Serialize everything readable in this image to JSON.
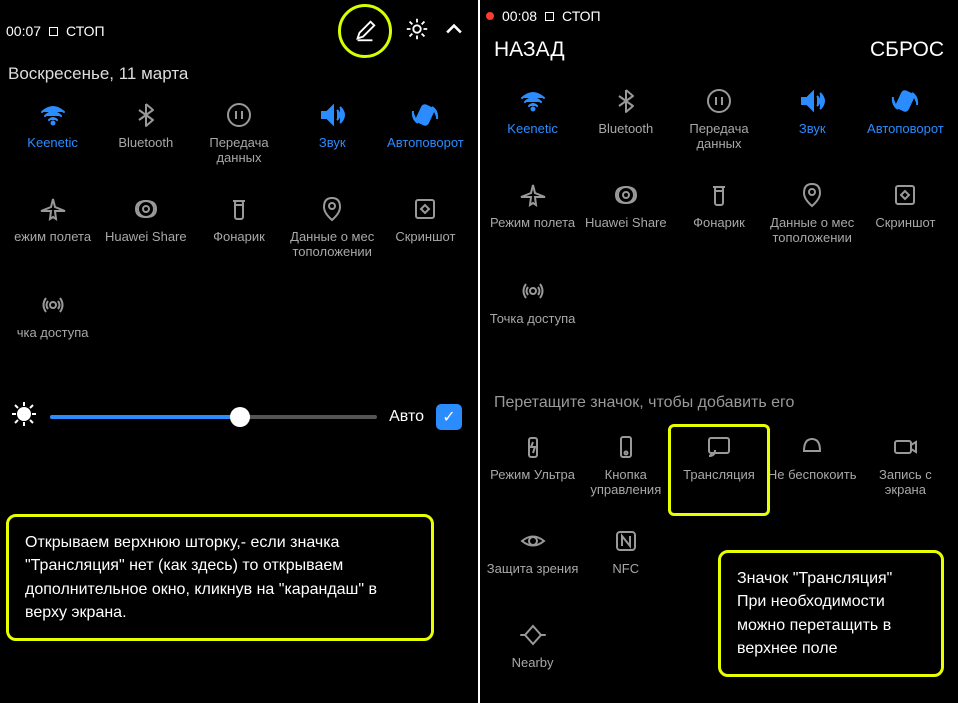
{
  "left": {
    "time": "00:07",
    "stop": "СТОП",
    "date": "Воскресенье, 11 марта",
    "auto": "Авто",
    "brightness_pct": 58,
    "tiles_row1": [
      {
        "label": "Keenetic",
        "icon": "wifi",
        "active": true
      },
      {
        "label": "Bluetooth",
        "icon": "bluetooth",
        "active": false
      },
      {
        "label": "Передача данных",
        "icon": "data",
        "active": false
      },
      {
        "label": "Звук",
        "icon": "sound",
        "active": true
      },
      {
        "label": "Автоповорот",
        "icon": "rotate",
        "active": true
      }
    ],
    "tiles_row2": [
      {
        "label": "ежим полета",
        "icon": "airplane",
        "active": false
      },
      {
        "label": "Huawei Share",
        "icon": "share",
        "active": false
      },
      {
        "label": "Фонарик",
        "icon": "flashlight",
        "active": false
      },
      {
        "label": "Данные о мес тоположении",
        "icon": "location",
        "active": false
      },
      {
        "label": "Скриншот",
        "icon": "screenshot",
        "active": false
      }
    ],
    "tiles_row3": [
      {
        "label": "чка доступа",
        "icon": "hotspot",
        "active": false
      }
    ],
    "callout": "Открываем верхнюю шторку,- если значка \"Трансляция\" нет (как здесь) то открываем дополнительное окно, кликнув на \"карандаш\" в верху экрана."
  },
  "right": {
    "time": "00:08",
    "stop": "СТОП",
    "nav_back": "НАЗАД",
    "nav_reset": "СБРОС",
    "tiles_row1": [
      {
        "label": "Keenetic",
        "icon": "wifi",
        "active": true
      },
      {
        "label": "Bluetooth",
        "icon": "bluetooth",
        "active": false
      },
      {
        "label": "Передача данных",
        "icon": "data",
        "active": false
      },
      {
        "label": "Звук",
        "icon": "sound",
        "active": true
      },
      {
        "label": "Автоповорот",
        "icon": "rotate",
        "active": true
      }
    ],
    "tiles_row2": [
      {
        "label": "Режим полета",
        "icon": "airplane",
        "active": false
      },
      {
        "label": "Huawei Share",
        "icon": "share",
        "active": false
      },
      {
        "label": "Фонарик",
        "icon": "flashlight",
        "active": false
      },
      {
        "label": "Данные о мес тоположении",
        "icon": "location",
        "active": false
      },
      {
        "label": "Скриншот",
        "icon": "screenshot",
        "active": false
      }
    ],
    "tiles_row3": [
      {
        "label": "Точка доступа",
        "icon": "hotspot",
        "active": false
      }
    ],
    "drag_hint": "Перетащите значок, чтобы добавить его",
    "tiles_more1": [
      {
        "label": "Режим Ультра",
        "icon": "battery",
        "active": false
      },
      {
        "label": "Кнопка управления",
        "icon": "navbtn",
        "active": false
      },
      {
        "label": "Трансляция",
        "icon": "cast",
        "active": false,
        "highlight": true
      },
      {
        "label": "Не беспокоить",
        "icon": "dnd",
        "active": false
      },
      {
        "label": "Запись с экрана",
        "icon": "record",
        "active": false
      }
    ],
    "tiles_more2": [
      {
        "label": "Защита зрения",
        "icon": "eye",
        "active": false
      },
      {
        "label": "NFC",
        "icon": "nfc",
        "active": false
      }
    ],
    "tiles_more3": [
      {
        "label": "Nearby",
        "icon": "nearby",
        "active": false
      }
    ],
    "callout": "Значок \"Трансляция\" При необходимости можно перетащить в верхнее поле"
  }
}
